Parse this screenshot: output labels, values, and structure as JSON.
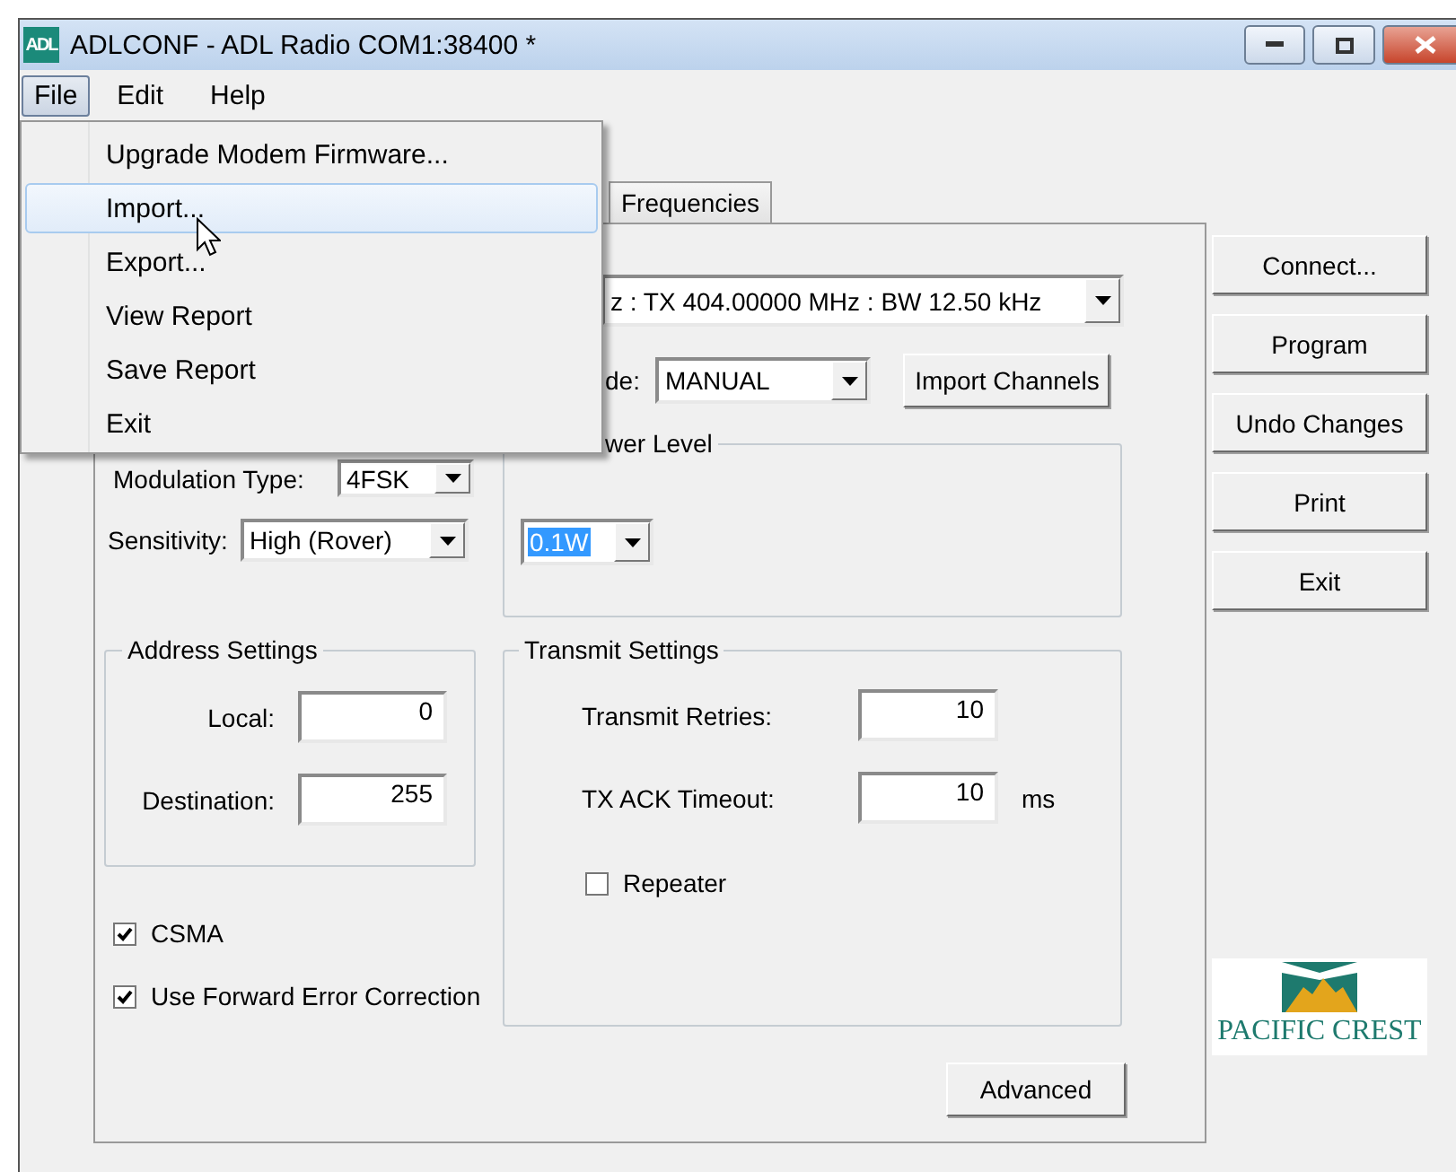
{
  "window": {
    "title": "ADLCONF - ADL Radio COM1:38400 *",
    "icon_label": "ADL"
  },
  "menu_bar": [
    {
      "label": "File",
      "selected": true
    },
    {
      "label": "Edit",
      "selected": false
    },
    {
      "label": "Help",
      "selected": false
    }
  ],
  "open_menu": {
    "items": [
      {
        "label": "Upgrade Modem Firmware...",
        "selected": false
      },
      {
        "label": "Import...",
        "selected": true
      },
      {
        "label": "Export...",
        "selected": false
      },
      {
        "label": "View Report",
        "selected": false
      },
      {
        "label": "Save Report",
        "selected": false
      },
      {
        "label": "Exit",
        "selected": false
      }
    ]
  },
  "tabs": [
    {
      "label": "Frequencies",
      "selected": false
    }
  ],
  "channel_select": {
    "value": "z : TX 404.00000 MHz : BW 12.50 kHz"
  },
  "mode": {
    "label": "de:",
    "value": "MANUAL"
  },
  "import_channels_button": "Import Channels",
  "modulation": {
    "label": "Modulation Type:",
    "value": "4FSK"
  },
  "sensitivity": {
    "label": "Sensitivity:",
    "value": "High (Rover)"
  },
  "power_level": {
    "title": "wer Level",
    "value": "0.1W",
    "highlighted": true
  },
  "address_settings": {
    "title": "Address Settings",
    "fields": [
      {
        "label": "Local:",
        "value": "0"
      },
      {
        "label": "Destination:",
        "value": "255"
      }
    ]
  },
  "transmit_settings": {
    "title": "Transmit Settings",
    "fields": [
      {
        "label": "Transmit Retries:",
        "value": "10"
      },
      {
        "label": "TX ACK Timeout:",
        "value": "10",
        "unit": "ms"
      }
    ],
    "repeater": {
      "label": "Repeater",
      "checked": false
    }
  },
  "options": [
    {
      "label": "CSMA",
      "checked": true
    },
    {
      "label": "Use Forward Error Correction",
      "checked": true
    }
  ],
  "advanced_button": "Advanced",
  "side_buttons": [
    "Connect...",
    "Program",
    "Undo Changes",
    "Print",
    "Exit"
  ],
  "logo": {
    "text": "PACIFIC CREST"
  }
}
